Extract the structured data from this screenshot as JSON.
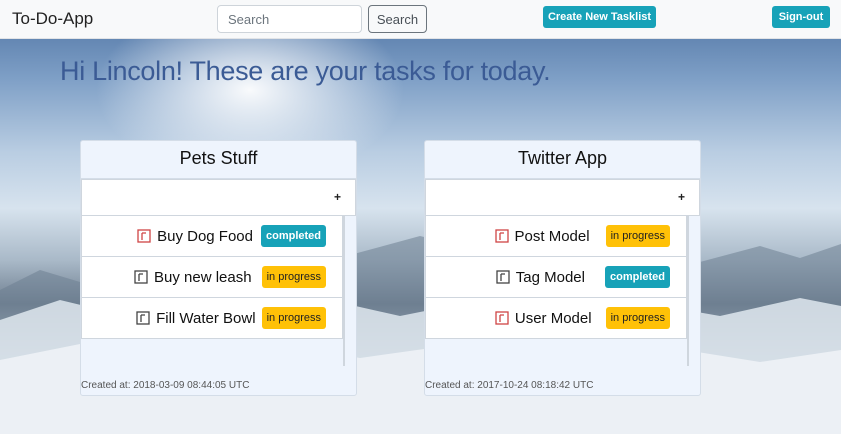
{
  "navbar": {
    "brand": "To-Do-App",
    "search_placeholder": "Search",
    "search_button": "Search",
    "create_button": "Create New Tasklist",
    "signout_button": "Sign-out"
  },
  "greeting": "Hi Lincoln! These are your tasks for today.",
  "tasklists": [
    {
      "title": "Pets Stuff",
      "add_label": "+",
      "created": "Created at: 2018-03-09 08:44:05 UTC",
      "tasks": [
        {
          "name": "Buy Dog Food",
          "status": "completed",
          "icon": "note-red-icon"
        },
        {
          "name": "Buy new leash",
          "status": "in progress",
          "icon": "note-gray-icon"
        },
        {
          "name": "Fill Water Bowl",
          "status": "in progress",
          "icon": "note-gray-icon"
        }
      ]
    },
    {
      "title": "Twitter App",
      "add_label": "+",
      "created": "Created at: 2017-10-24 08:18:42 UTC",
      "tasks": [
        {
          "name": "Post Model",
          "status": "in progress",
          "icon": "note-red-icon"
        },
        {
          "name": "Tag Model",
          "status": "completed",
          "icon": "note-gray-icon"
        },
        {
          "name": "User Model",
          "status": "in progress",
          "icon": "note-red-icon"
        }
      ]
    }
  ],
  "colors": {
    "accent": "#17a2b8",
    "warning": "#ffc107",
    "greeting": "#3b5b95"
  }
}
